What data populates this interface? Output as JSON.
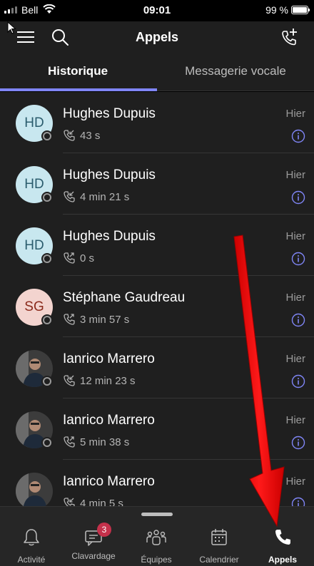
{
  "status_bar": {
    "carrier": "Bell",
    "time": "09:01",
    "battery": "99 %",
    "battery_level": 0.99
  },
  "header": {
    "title": "Appels",
    "menu_icon": "hamburger-menu-icon",
    "search_icon": "search-icon",
    "add_call_icon": "phone-add-icon"
  },
  "tabs": [
    {
      "label": "Historique",
      "active": true
    },
    {
      "label": "Messagerie vocale",
      "active": false
    }
  ],
  "calls": [
    {
      "initials": "HD",
      "name": "Hughes Dupuis",
      "direction": "incoming",
      "duration": "43 s",
      "when": "Hier",
      "avatar_type": "initials",
      "avatar_color": "#c8e7ef"
    },
    {
      "initials": "HD",
      "name": "Hughes Dupuis",
      "direction": "incoming",
      "duration": "4 min 21 s",
      "when": "Hier",
      "avatar_type": "initials",
      "avatar_color": "#c8e7ef"
    },
    {
      "initials": "HD",
      "name": "Hughes Dupuis",
      "direction": "outgoing",
      "duration": "0 s",
      "when": "Hier",
      "avatar_type": "initials",
      "avatar_color": "#c8e7ef"
    },
    {
      "initials": "SG",
      "name": "Stéphane Gaudreau",
      "direction": "outgoing",
      "duration": "3 min 57 s",
      "when": "Hier",
      "avatar_type": "initials",
      "avatar_color": "#f3d4cf"
    },
    {
      "name": "Ianrico Marrero",
      "direction": "incoming",
      "duration": "12 min 23 s",
      "when": "Hier",
      "avatar_type": "photo"
    },
    {
      "name": "Ianrico Marrero",
      "direction": "outgoing",
      "duration": "5 min 38 s",
      "when": "Hier",
      "avatar_type": "photo"
    },
    {
      "name": "Ianrico Marrero",
      "direction": "incoming",
      "duration": "4 min 5 s",
      "when": "Hier",
      "avatar_type": "photo"
    }
  ],
  "bottom_nav": [
    {
      "label": "Activité",
      "icon": "bell-icon",
      "active": false
    },
    {
      "label": "Clavardage",
      "icon": "chat-icon",
      "active": false,
      "badge": "3"
    },
    {
      "label": "Équipes",
      "icon": "teams-icon",
      "active": false
    },
    {
      "label": "Calendrier",
      "icon": "calendar-icon",
      "active": false
    },
    {
      "label": "Appels",
      "icon": "phone-icon",
      "active": true
    }
  ],
  "colors": {
    "accent": "#7f85f5",
    "annotation_arrow": "#ff0000",
    "badge": "#c4314b"
  }
}
